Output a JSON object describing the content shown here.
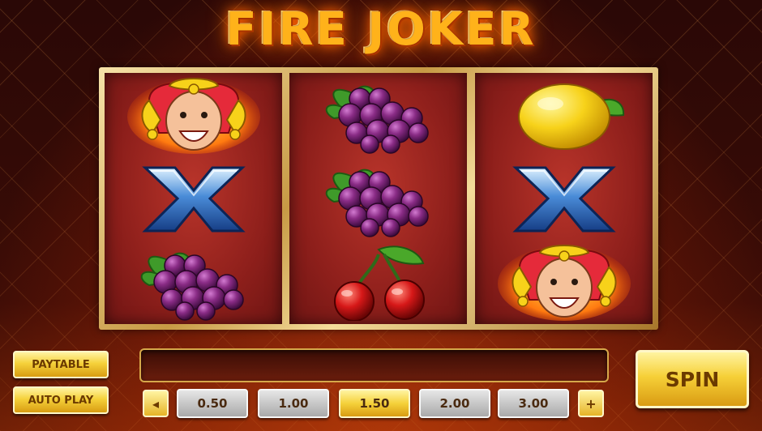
{
  "game": {
    "title": "FIRE JOKER"
  },
  "reels": [
    [
      "joker",
      "x",
      "grapes"
    ],
    [
      "grapes",
      "grapes",
      "cherries"
    ],
    [
      "lemon",
      "x",
      "joker"
    ]
  ],
  "controls": {
    "paytable_label": "PAYTABLE",
    "autoplay_label": "AUTO PLAY",
    "spin_label": "SPIN",
    "decrease_label": "◂",
    "increase_label": "+",
    "message": ""
  },
  "bets": {
    "options": [
      "0.50",
      "1.00",
      "1.50",
      "2.00",
      "3.00"
    ],
    "selected": "1.50"
  },
  "colors": {
    "title": "#ffb21a",
    "button": "#f5d13a",
    "reel_bg": "#8e1f1b",
    "frame": "#d6a84a"
  }
}
